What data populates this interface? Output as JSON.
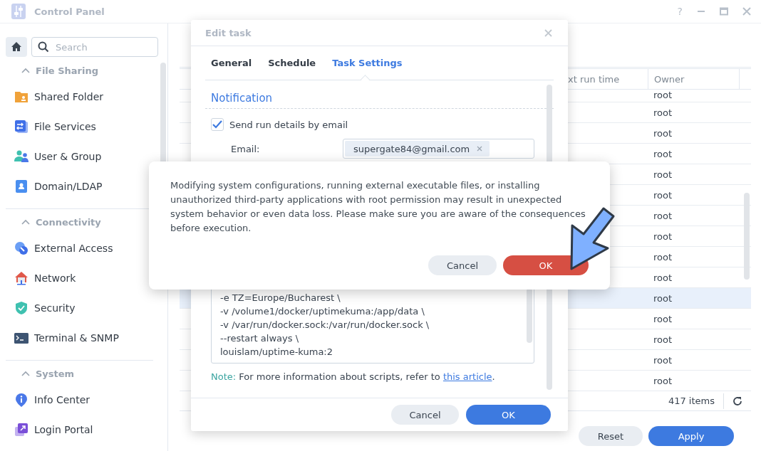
{
  "window": {
    "title": "Control Panel",
    "help": "?"
  },
  "sidebar": {
    "search": {
      "placeholder": "Search"
    },
    "groups": [
      {
        "label": "File Sharing",
        "expanded": true,
        "items": [
          {
            "label": "Shared Folder",
            "kind": "folder",
            "selected": false
          },
          {
            "label": "File Services",
            "kind": "services",
            "selected": false
          },
          {
            "label": "User & Group",
            "kind": "users",
            "selected": false
          },
          {
            "label": "Domain/LDAP",
            "kind": "domain",
            "selected": false
          }
        ]
      },
      {
        "label": "Connectivity",
        "expanded": true,
        "items": [
          {
            "label": "External Access",
            "kind": "external",
            "selected": false
          },
          {
            "label": "Network",
            "kind": "network",
            "selected": false
          },
          {
            "label": "Security",
            "kind": "security",
            "selected": false
          },
          {
            "label": "Terminal & SNMP",
            "kind": "terminal",
            "selected": false
          }
        ]
      },
      {
        "label": "System",
        "expanded": true,
        "items": [
          {
            "label": "Info Center",
            "kind": "info",
            "selected": false
          },
          {
            "label": "Login Portal",
            "kind": "portal",
            "selected": false
          }
        ]
      }
    ]
  },
  "table": {
    "columns": [
      "xt run time",
      "Owner"
    ],
    "rows": [
      {
        "owner": "root",
        "selected": false
      },
      {
        "owner": "root",
        "selected": false
      },
      {
        "owner": "root",
        "selected": false
      },
      {
        "owner": "root",
        "selected": false
      },
      {
        "owner": "root",
        "selected": false
      },
      {
        "owner": "root",
        "selected": false
      },
      {
        "owner": "root",
        "selected": false
      },
      {
        "owner": "root",
        "selected": false
      },
      {
        "owner": "root",
        "selected": false
      },
      {
        "owner": "root",
        "selected": false
      },
      {
        "owner": "root",
        "selected": true
      },
      {
        "owner": "root",
        "selected": false
      },
      {
        "owner": "root",
        "selected": false
      },
      {
        "owner": "root",
        "selected": false
      },
      {
        "owner": "root",
        "selected": false
      }
    ],
    "count": "417 items"
  },
  "buttons": [
    {
      "label": "Reset",
      "kind": "secondary"
    },
    {
      "label": "Apply",
      "kind": "primary"
    }
  ],
  "edit_dialog": {
    "title": "Edit task",
    "tabs": [
      {
        "label": "General",
        "selected": false
      },
      {
        "label": "Schedule",
        "selected": false
      },
      {
        "label": "Task Settings",
        "selected": true
      }
    ],
    "section": "Notification",
    "send_email": {
      "label": "Send run details by email",
      "checked": true
    },
    "email": {
      "label": "Email:",
      "value": "supergate84@gmail.com"
    },
    "script": [
      "-e TZ=Europe/Bucharest \\",
      "-v /volume1/docker/uptimekuma:/app/data \\",
      "-v /var/run/docker.sock:/var/run/docker.sock \\",
      "--restart always \\",
      "louislam/uptime-kuma:2"
    ],
    "note": {
      "label": "Note:",
      "text": "For more information about scripts, refer to",
      "link": "this article",
      "end": "."
    },
    "buttons": [
      {
        "label": "Cancel",
        "kind": "secondary"
      },
      {
        "label": "OK",
        "kind": "primary"
      }
    ]
  },
  "confirm_dialog": {
    "message": "Modifying system configurations, running external executable files, or installing unauthorized third-party applications with root permission may result in unexpected system behavior or even data loss. Please make sure you are aware of the consequences before execution.",
    "buttons": [
      {
        "label": "Cancel",
        "kind": "secondary"
      },
      {
        "label": "OK",
        "kind": "danger"
      }
    ]
  }
}
